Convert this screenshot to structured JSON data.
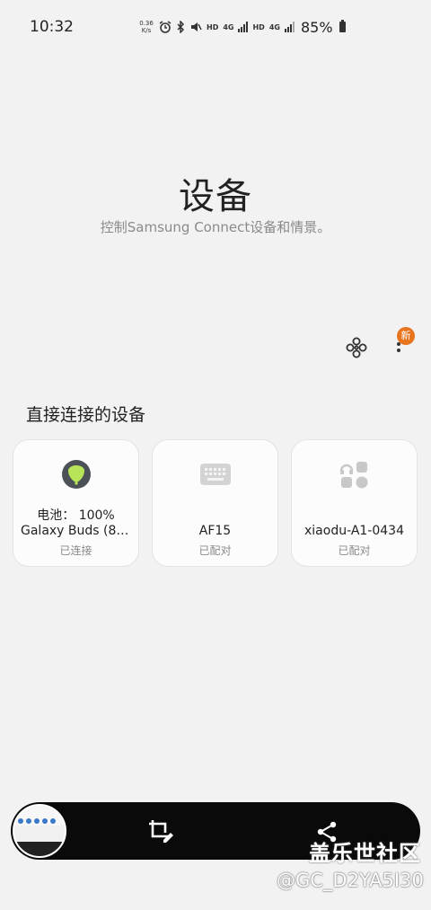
{
  "status_bar": {
    "time": "10:32",
    "net_speed_value": "0.36",
    "net_speed_unit": "K/s",
    "sim1_label": "HD",
    "sim1_net": "4G",
    "sim2_label": "HD",
    "sim2_net": "4G",
    "battery": "85%",
    "icons": [
      "alarm-icon",
      "bluetooth-icon",
      "mute-icon",
      "signal-icon",
      "battery-icon"
    ]
  },
  "header": {
    "title": "设备",
    "subtitle": "控制Samsung Connect设备和情景。"
  },
  "toolbar": {
    "new_badge": "新"
  },
  "section": {
    "title": "直接连接的设备"
  },
  "devices": [
    {
      "battery": "电池：  100%",
      "name": "Galaxy Buds (88…",
      "status": "已连接",
      "icon": "buds-icon"
    },
    {
      "name": "AF15",
      "status": "已配对",
      "icon": "keyboard-icon"
    },
    {
      "name": "xiaodu-A1-0434",
      "status": "已配对",
      "icon": "headphones-icon"
    }
  ],
  "watermark": {
    "brand": "盖乐世社区",
    "handle": "@GC_D2YA5I30"
  }
}
